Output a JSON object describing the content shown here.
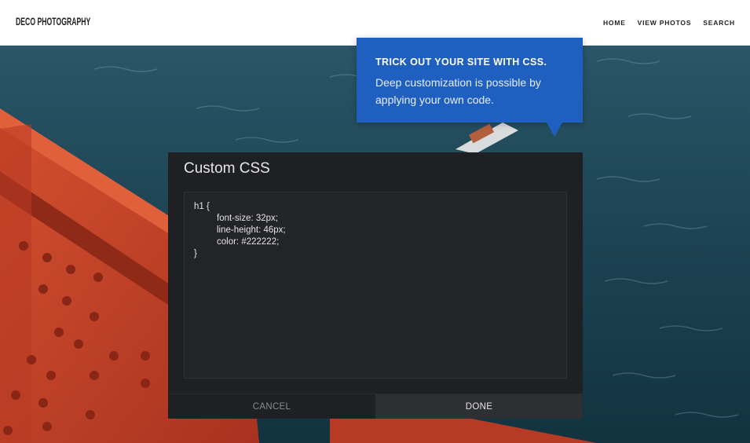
{
  "site": {
    "logo": "Deco Photography",
    "nav": [
      "HOME",
      "VIEW PHOTOS",
      "SEARCH"
    ]
  },
  "tooltip": {
    "title": "TRICK OUT YOUR SITE WITH CSS.",
    "body": "Deep customization is possible by applying your own code."
  },
  "dialog": {
    "title": "Custom CSS",
    "code": [
      "h1 {",
      "font-size: 32px;",
      "line-height: 46px;",
      "color: #222222;",
      "}"
    ],
    "cancel_label": "CANCEL",
    "done_label": "DONE"
  },
  "colors": {
    "tooltip_bg": "#1f5fbf",
    "dialog_bg": "#1f2023",
    "bridge_red": "#c5412a",
    "water": "#1e4655"
  }
}
